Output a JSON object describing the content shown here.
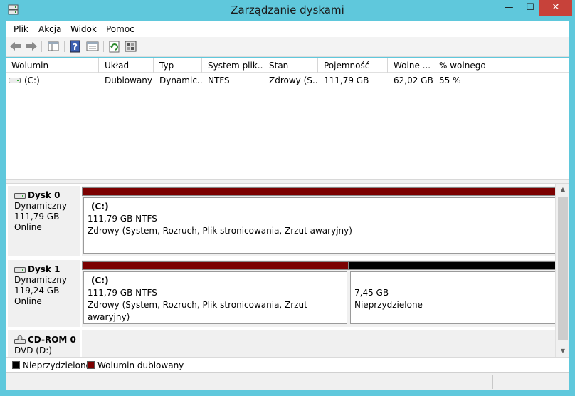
{
  "window": {
    "title": "Zarządzanie dyskami",
    "minimize": "—",
    "maximize": "☐",
    "close": "✕"
  },
  "menu": {
    "items": [
      "Plik",
      "Akcja",
      "Widok",
      "Pomoc"
    ]
  },
  "toolbar": {
    "icons": [
      "back-arrow-icon",
      "forward-arrow-icon",
      "console-tree-icon",
      "help-icon",
      "properties-icon",
      "refresh-icon",
      "rescan-disks-icon"
    ]
  },
  "volume_list": {
    "columns": [
      "Wolumin",
      "Układ",
      "Typ",
      "System plik...",
      "Stan",
      "Pojemność",
      "Wolne ...",
      "% wolnego"
    ],
    "rows": [
      {
        "volume": "(C:)",
        "layout": "Dublowany",
        "type": "Dynamic...",
        "filesystem": "NTFS",
        "status": "Zdrowy (S...",
        "capacity": "111,79 GB",
        "free": "62,02 GB",
        "percent_free": "55 %"
      }
    ]
  },
  "disks": [
    {
      "name": "Dysk 0",
      "kind": "Dynamiczny",
      "size": "111,79 GB",
      "state": "Online",
      "partitions": [
        {
          "volume": "(C:)",
          "size_fs": "111,79 GB NTFS",
          "status": "Zdrowy (System, Rozruch, Plik stronicowania, Zrzut awaryjny)",
          "color": "#7b0000"
        }
      ]
    },
    {
      "name": "Dysk 1",
      "kind": "Dynamiczny",
      "size": "119,24 GB",
      "state": "Online",
      "partitions": [
        {
          "volume": "(C:)",
          "size_fs": "111,79 GB NTFS",
          "status": "Zdrowy (System, Rozruch, Plik stronicowania, Zrzut awaryjny)",
          "color": "#7b0000"
        },
        {
          "size_fs": "7,45 GB",
          "status": "Nieprzydzielone",
          "color": "#000000"
        }
      ]
    },
    {
      "name": "CD-ROM 0",
      "kind": "DVD (D:)"
    }
  ],
  "legend": [
    {
      "label": "Nieprzydzielone",
      "color": "#000000"
    },
    {
      "label": "Wolumin dublowany",
      "color": "#7b0000"
    }
  ]
}
